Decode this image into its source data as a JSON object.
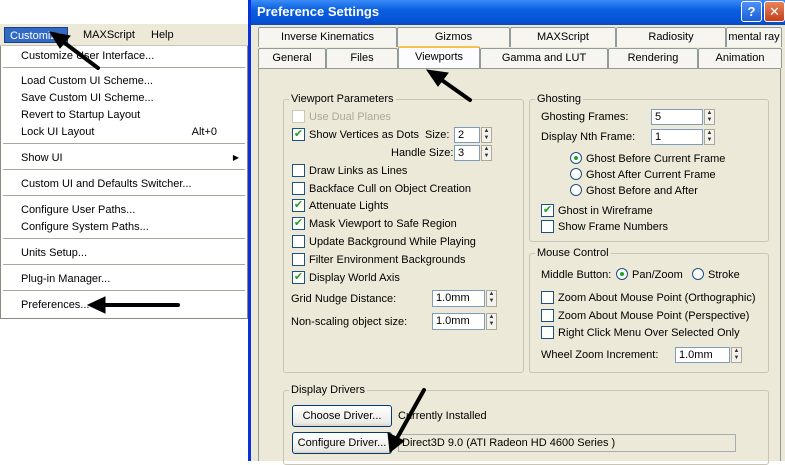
{
  "menubar": {
    "items": [
      "Customize",
      "MAXScript",
      "Help"
    ]
  },
  "customize_menu": {
    "items": [
      {
        "label": "Customize User Interface..."
      },
      {
        "label": "Load Custom UI Scheme..."
      },
      {
        "label": "Save Custom UI Scheme..."
      },
      {
        "label": "Revert to Startup Layout"
      },
      {
        "label": "Lock UI Layout",
        "shortcut": "Alt+0"
      },
      {
        "label": "Show UI"
      },
      {
        "label": "Custom UI and Defaults Switcher..."
      },
      {
        "label": "Configure User Paths..."
      },
      {
        "label": "Configure System Paths..."
      },
      {
        "label": "Units Setup..."
      },
      {
        "label": "Plug-in Manager..."
      },
      {
        "label": "Preferences..."
      }
    ]
  },
  "dialog": {
    "title": "Preference Settings",
    "help_glyph": "?",
    "close_glyph": "✕",
    "tabs_row1": [
      "Inverse Kinematics",
      "Gizmos",
      "MAXScript",
      "Radiosity",
      "mental ray"
    ],
    "tabs_row2": [
      "General",
      "Files",
      "Viewports",
      "Gamma and LUT",
      "Rendering",
      "Animation"
    ],
    "active_tab": "Viewports"
  },
  "viewport_params": {
    "label": "Viewport Parameters",
    "use_dual_planes": "Use Dual Planes",
    "show_vertices": "Show Vertices as Dots",
    "size_label": "Size:",
    "size_value": "2",
    "handle_size_label": "Handle Size:",
    "handle_size_value": "3",
    "draw_links": "Draw Links as Lines",
    "backface_cull": "Backface Cull on Object Creation",
    "attenuate_lights": "Attenuate Lights",
    "mask_viewport": "Mask Viewport to Safe Region",
    "update_background": "Update Background While Playing",
    "filter_env": "Filter Environment Backgrounds",
    "display_world_axis": "Display World Axis",
    "grid_nudge_label": "Grid Nudge Distance:",
    "grid_nudge_value": "1.0mm",
    "nonscaling_label": "Non-scaling object size:",
    "nonscaling_value": "1.0mm"
  },
  "ghosting": {
    "label": "Ghosting",
    "frames_label": "Ghosting Frames:",
    "frames_value": "5",
    "nth_label": "Display Nth Frame:",
    "nth_value": "1",
    "before": "Ghost Before Current Frame",
    "after": "Ghost After Current Frame",
    "before_after": "Ghost Before and After",
    "wireframe": "Ghost in Wireframe",
    "show_numbers": "Show Frame Numbers"
  },
  "mouse_control": {
    "label": "Mouse Control",
    "middle_label": "Middle Button:",
    "pan_zoom": "Pan/Zoom",
    "stroke": "Stroke",
    "zoom_ortho": "Zoom About Mouse Point (Orthographic)",
    "zoom_persp": "Zoom About Mouse Point (Perspective)",
    "right_click": "Right Click Menu Over Selected Only",
    "wheel_label": "Wheel Zoom Increment:",
    "wheel_value": "1.0mm"
  },
  "display_drivers": {
    "label": "Display Drivers",
    "choose": "Choose Driver...",
    "installed": "Currently Installed",
    "configure": "Configure Driver...",
    "driver_value": "Direct3D 9.0 (ATI Radeon HD 4600 Series )"
  },
  "icons": {
    "check": "✔",
    "submenu": "▶",
    "spin_up": "▲",
    "spin_down": "▼"
  }
}
